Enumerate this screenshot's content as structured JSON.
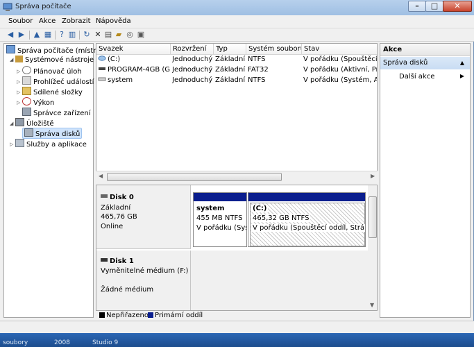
{
  "window": {
    "title": "Správa počítače"
  },
  "menu": [
    "Soubor",
    "Akce",
    "Zobrazit",
    "Nápověda"
  ],
  "tree": {
    "root": "Správa počítače (místní)",
    "system_tools": "Systémové nástroje",
    "task_scheduler": "Plánovač úloh",
    "event_viewer": "Prohlížeč událostí",
    "shared_folders": "Sdílené složky",
    "performance": "Výkon",
    "device_manager": "Správce zařízení",
    "storage": "Úložiště",
    "disk_management": "Správa disků",
    "services_apps": "Služby a aplikace"
  },
  "volume_list": {
    "columns": [
      "Svazek",
      "Rozvržení",
      "Typ",
      "Systém souborů",
      "Stav"
    ],
    "rows": [
      [
        "(C:)",
        "Jednoduchý",
        "Základní",
        "NTFS",
        "V pořádku (Spouštěcí oddíl, Stránkový soubor"
      ],
      [
        "PROGRAM-4GB (G:)",
        "Jednoduchý",
        "Základní",
        "FAT32",
        "V pořádku (Aktivní, Primární oddíl)"
      ],
      [
        "system",
        "Jednoduchý",
        "Základní",
        "NTFS",
        "V pořádku (Systém, Aktivní, Primární oddíl)"
      ]
    ]
  },
  "disks": {
    "disk0": {
      "name": "Disk 0",
      "type": "Základní",
      "size": "465,76 GB",
      "status": "Online",
      "partitions": [
        {
          "name": "system",
          "size": "455 MB NTFS",
          "status": "V pořádku (Syst"
        },
        {
          "name": "(C:)",
          "size": "465,32 GB NTFS",
          "status": "V pořádku (Spouštěcí oddíl, Stránkc"
        }
      ]
    },
    "disk1": {
      "name": "Disk 1",
      "type": "Vyměnitelné médium (F:)",
      "media": "Žádné médium"
    }
  },
  "legend": {
    "unallocated": "Nepřiřazeno",
    "primary": "Primární oddíl"
  },
  "actions": {
    "header": "Akce",
    "section": "Správa disků",
    "more": "Další akce"
  },
  "taskbar": [
    "soubory",
    "2008",
    "Studio 9"
  ],
  "colors": {
    "primary_partition": "#0a1e8e",
    "selection": "#cfe3fb",
    "titlebar": "#9fbfe3"
  }
}
